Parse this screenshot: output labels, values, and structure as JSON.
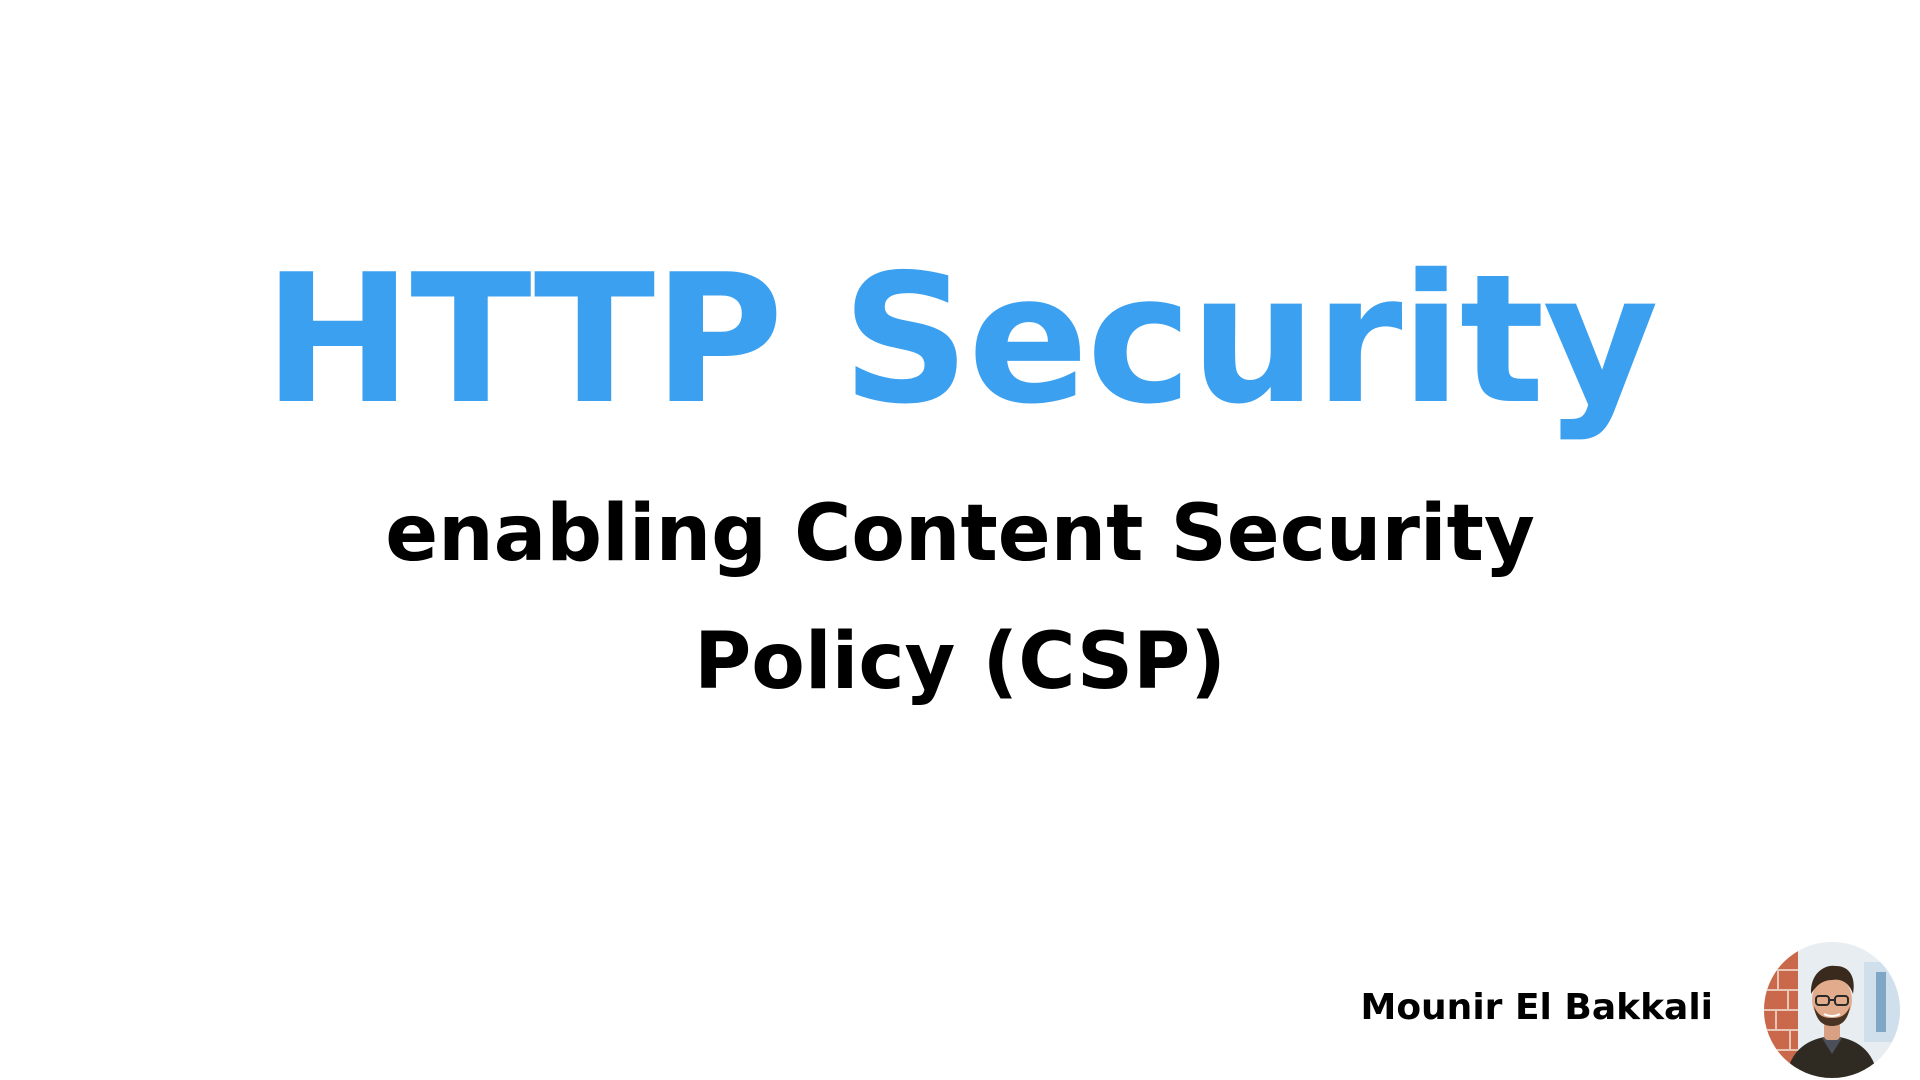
{
  "slide": {
    "title": "HTTP Security",
    "subtitle_line1": "enabling Content Security",
    "subtitle_line2": "Policy (CSP)",
    "author": "Mounir El Bakkali",
    "avatar_icon": "author-portrait",
    "colors": {
      "title": "#3ca0f0",
      "text": "#000000",
      "background": "#ffffff"
    }
  }
}
